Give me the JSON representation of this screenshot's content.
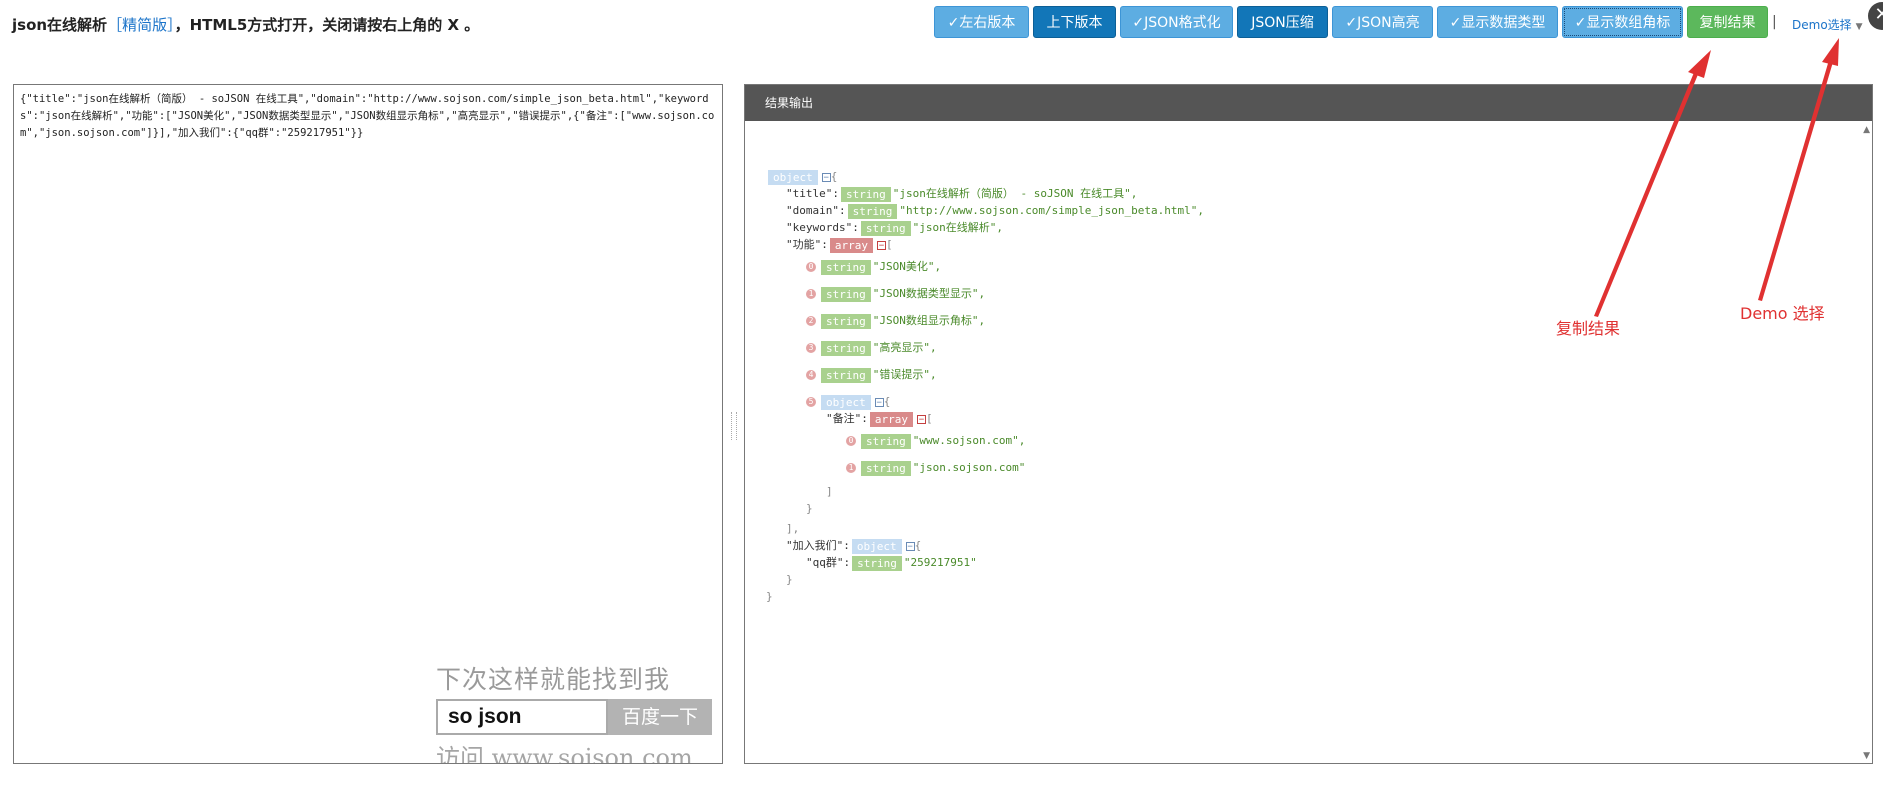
{
  "header": {
    "title_prefix": "json在线解析",
    "title_lite": "［精简版］",
    "title_suffix": "，HTML5方式打开，关闭请按右上角的 X 。"
  },
  "toolbar": {
    "left_right": "✓左右版本",
    "up_down": "上下版本",
    "format": "✓JSON格式化",
    "compress": "JSON压缩",
    "highlight": "✓JSON高亮",
    "show_types": "✓显示数据类型",
    "show_index": "✓显示数组角标",
    "copy": "复制结果",
    "separator": "|",
    "demo": "Demo选择",
    "demo_caret": "▼",
    "close": "✕"
  },
  "input": {
    "value": "{\"title\":\"json在线解析（简版） - soJSON 在线工具\",\"domain\":\"http://www.sojson.com/simple_json_beta.html\",\"keywords\":\"json在线解析\",\"功能\":[\"JSON美化\",\"JSON数据类型显示\",\"JSON数组显示角标\",\"高亮显示\",\"错误提示\",{\"备注\":[\"www.sojson.com\",\"json.sojson.com\"]}],\"加入我们\":{\"qq群\":\"259217951\"}}"
  },
  "ad": {
    "top": "下次这样就能找到我",
    "query": "so json",
    "button": "百度一下",
    "bottom": "访问 www.sojson.com"
  },
  "output": {
    "header": "结果输出",
    "scroll_up": "▲",
    "scroll_down": "▼",
    "types": {
      "object": "object",
      "string": "string",
      "array": "array"
    },
    "toggle": "−",
    "keys": {
      "title": "\"title\":",
      "domain": "\"domain\":",
      "keywords": "\"keywords\":",
      "features": "\"功能\":",
      "remark": "\"备注\":",
      "join": "\"加入我们\":",
      "qq": "\"qq群\":"
    },
    "values": {
      "title": "\"json在线解析（简版） - soJSON 在线工具\",",
      "domain": "\"http://www.sojson.com/simple_json_beta.html\",",
      "keywords": "\"json在线解析\",",
      "f0": "\"JSON美化\",",
      "f1": "\"JSON数据类型显示\",",
      "f2": "\"JSON数组显示角标\",",
      "f3": "\"高亮显示\",",
      "f4": "\"错误提示\",",
      "r0": "\"www.sojson.com\",",
      "r1": "\"json.sojson.com\"",
      "qq": "\"259217951\""
    },
    "indices": [
      "0",
      "1",
      "2",
      "3",
      "4",
      "5"
    ],
    "brackets": {
      "obj_open": "{",
      "obj_close": "}",
      "arr_open": "[",
      "arr_close": "]",
      "arr_close_comma": "],"
    }
  },
  "annotations": {
    "copy_label": "复制结果",
    "demo_label": "Demo 选择",
    "color": "#e03131"
  }
}
